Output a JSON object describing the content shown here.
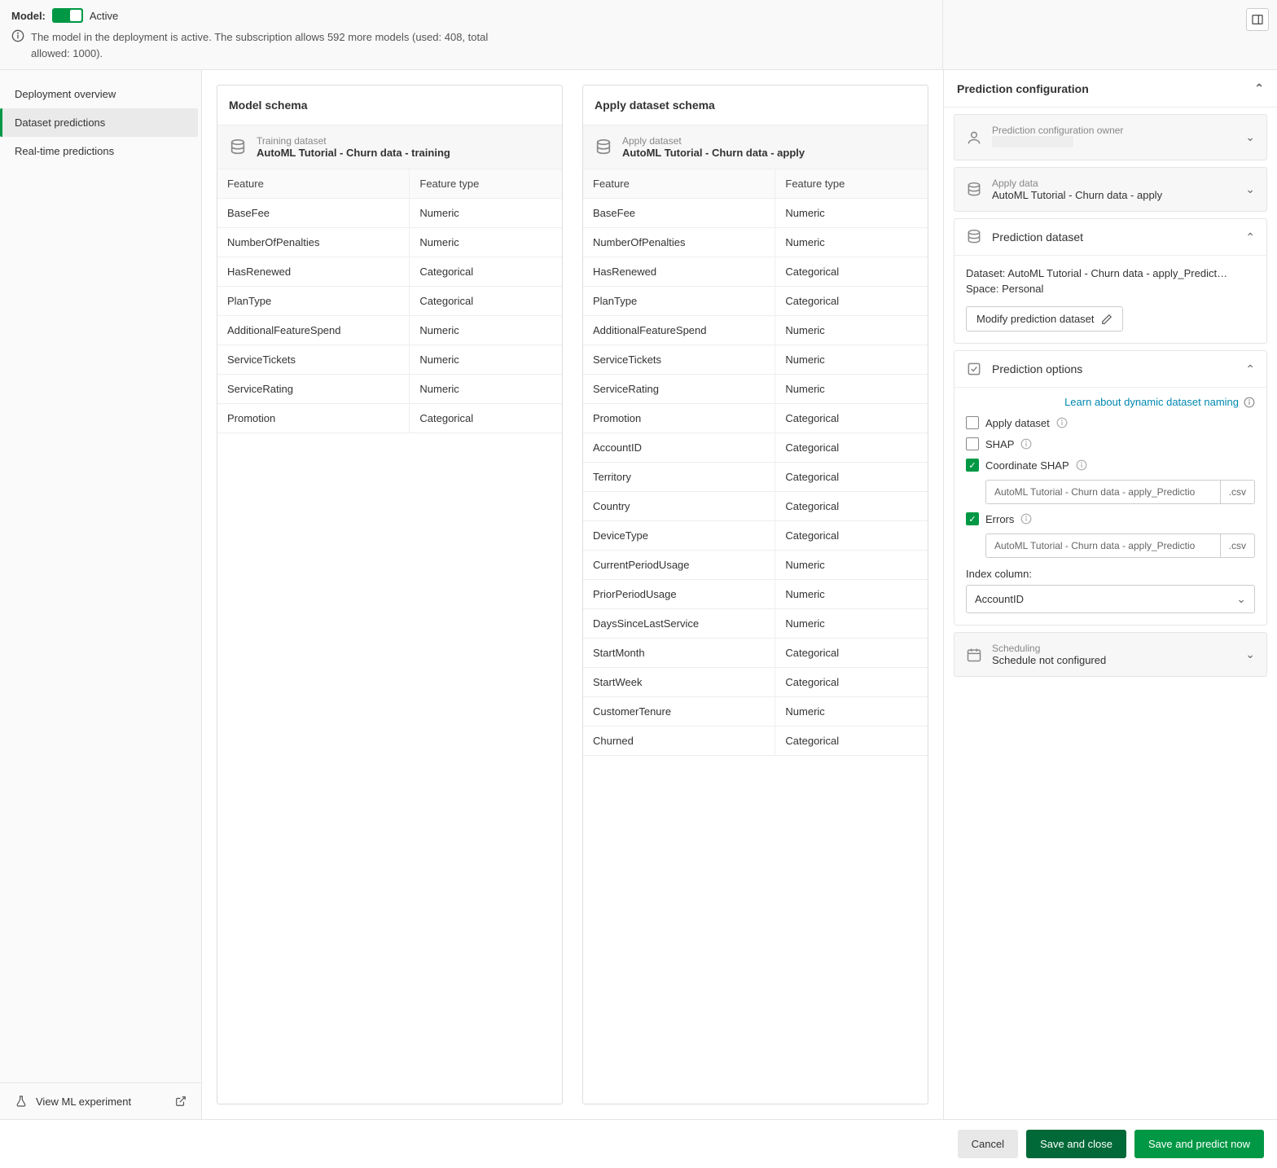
{
  "header": {
    "model_label": "Model:",
    "active_text": "Active",
    "info_text": "The model in the deployment is active. The subscription allows 592 more models (used: 408, total allowed: 1000)."
  },
  "sidebar": {
    "items": [
      {
        "label": "Deployment overview"
      },
      {
        "label": "Dataset predictions"
      },
      {
        "label": "Real-time predictions"
      }
    ],
    "view_experiment": "View ML experiment"
  },
  "model_schema": {
    "title": "Model schema",
    "dataset_label": "Training dataset",
    "dataset_name": "AutoML Tutorial - Churn data - training",
    "col_feature": "Feature",
    "col_type": "Feature type",
    "rows": [
      {
        "f": "BaseFee",
        "t": "Numeric"
      },
      {
        "f": "NumberOfPenalties",
        "t": "Numeric"
      },
      {
        "f": "HasRenewed",
        "t": "Categorical"
      },
      {
        "f": "PlanType",
        "t": "Categorical"
      },
      {
        "f": "AdditionalFeatureSpend",
        "t": "Numeric"
      },
      {
        "f": "ServiceTickets",
        "t": "Numeric"
      },
      {
        "f": "ServiceRating",
        "t": "Numeric"
      },
      {
        "f": "Promotion",
        "t": "Categorical"
      }
    ]
  },
  "apply_schema": {
    "title": "Apply dataset schema",
    "dataset_label": "Apply dataset",
    "dataset_name": "AutoML Tutorial - Churn data - apply",
    "col_feature": "Feature",
    "col_type": "Feature type",
    "rows": [
      {
        "f": "BaseFee",
        "t": "Numeric"
      },
      {
        "f": "NumberOfPenalties",
        "t": "Numeric"
      },
      {
        "f": "HasRenewed",
        "t": "Categorical"
      },
      {
        "f": "PlanType",
        "t": "Categorical"
      },
      {
        "f": "AdditionalFeatureSpend",
        "t": "Numeric"
      },
      {
        "f": "ServiceTickets",
        "t": "Numeric"
      },
      {
        "f": "ServiceRating",
        "t": "Numeric"
      },
      {
        "f": "Promotion",
        "t": "Categorical"
      },
      {
        "f": "AccountID",
        "t": "Categorical"
      },
      {
        "f": "Territory",
        "t": "Categorical"
      },
      {
        "f": "Country",
        "t": "Categorical"
      },
      {
        "f": "DeviceType",
        "t": "Categorical"
      },
      {
        "f": "CurrentPeriodUsage",
        "t": "Numeric"
      },
      {
        "f": "PriorPeriodUsage",
        "t": "Numeric"
      },
      {
        "f": "DaysSinceLastService",
        "t": "Numeric"
      },
      {
        "f": "StartMonth",
        "t": "Categorical"
      },
      {
        "f": "StartWeek",
        "t": "Categorical"
      },
      {
        "f": "CustomerTenure",
        "t": "Numeric"
      },
      {
        "f": "Churned",
        "t": "Categorical"
      }
    ]
  },
  "config": {
    "title": "Prediction configuration",
    "owner_label": "Prediction configuration owner",
    "apply_label": "Apply data",
    "apply_value": "AutoML Tutorial - Churn data - apply",
    "dataset_title": "Prediction dataset",
    "dataset_line": "Dataset: AutoML Tutorial - Churn data - apply_Predict…",
    "space_line": "Space: Personal",
    "modify_btn": "Modify prediction dataset",
    "options_title": "Prediction options",
    "learn_link": "Learn about dynamic dataset naming",
    "apply_dataset_label": "Apply dataset",
    "shap_label": "SHAP",
    "coord_shap_label": "Coordinate SHAP",
    "coord_shap_value": "AutoML Tutorial - Churn data - apply_Predictio",
    "errors_label": "Errors",
    "errors_value": "AutoML Tutorial - Churn data - apply_Predictio",
    "ext": ".csv",
    "index_label": "Index column:",
    "index_value": "AccountID",
    "scheduling_label": "Scheduling",
    "scheduling_value": "Schedule not configured"
  },
  "footer": {
    "cancel": "Cancel",
    "save": "Save and close",
    "predict": "Save and predict now"
  }
}
